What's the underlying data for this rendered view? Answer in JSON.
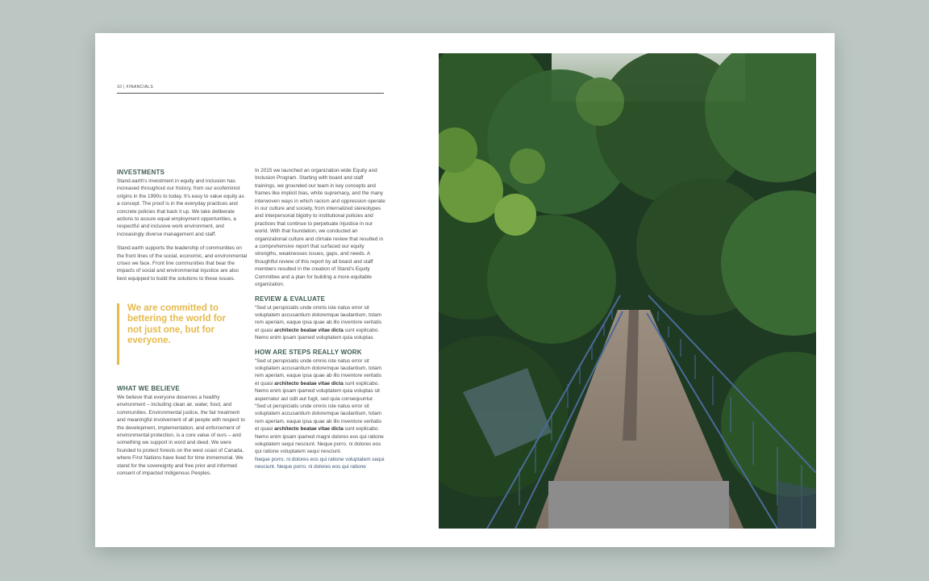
{
  "header": {
    "label": "10  |  FINANCIALS"
  },
  "investments": {
    "heading": "INVESTMENTS",
    "p1": "Stand.earth's investment in equity and inclusion has increased throughout our history, from our ecofeminist origins in the 1990s to today. It's easy to value equity as a concept. The proof is in the everyday practices and concrete policies that back it up. We take deliberate actions to assure equal employment opportunities, a respectful and inclusive work environment, and increasingly diverse management and staff.",
    "p2": "Stand.earth supports the leadership of communities on the front lines of the social, economic, and environmental crises we face. Front line communities that bear the impacts of social and environmental injustice are also best equipped to build the solutions to these issues."
  },
  "quote": {
    "text": "We are committed to bettering the world for not just one, but for everyone."
  },
  "believe": {
    "heading": "WHAT WE BELIEVE",
    "text": "We believe that everyone deserves a healthy environment – including clean air, water, food, and communities. Environmental justice, the fair treatment and meaningful involvement of all people with respect to the development, implementation, and enforcement of environmental protection, is a core value of ours – and something we support in word and deed. We were founded to protect forests on the west coast of Canada, where First Nations have lived for time immemorial. We stand for the sovereignty and free prior and informed consent of impacted Indigenous Peoples."
  },
  "intro": {
    "text": "In 2015 we launched an organization-wide Equity and Inclusion Program. Starting with board and staff trainings, we grounded our team in key concepts and frames like implicit bias, white supremacy, and the many interwoven ways in which racism and oppression operate in our culture and society, from internalized stereotypes and interpersonal bigotry to institutional policies and practices that continue to perpetuate injustice in our world. With that foundation, we conducted an organizational culture and climate review that resulted in a comprehensive report that surfaced our equity strengths, weaknesses issues, gaps, and needs. A thoughtful review of this report by all board and staff members resulted in the creation of Stand's Equity Committee and a plan for building a more equitable organization."
  },
  "review": {
    "heading": "REVIEW & EVALUATE",
    "before": "“Sed ut perspiciatis unde omnis iste natus error sit voluptatem accusantium doloremque laudantium, totam rem aperiam, eaque ipsa quae ab illo inventore veritatis et quasi ",
    "bold": "architecto beatae vitae dicta",
    "after": " sunt explicabo. Nemo enim ipsam ipamed voluptatem quia voluptas"
  },
  "steps": {
    "heading": "HOW ARE STEPS REALLY WORK",
    "a_before": "“Sed ut perspiciatis unde omnis iste natus error sit voluptatem accusantium doloremque laudantium, totam rem aperiam, eaque ipsa quae ab illo inventore veritatis et quasi ",
    "a_bold": "architecto beatae vitae dicta",
    "a_after": " sunt explicabo. Nemo enim ipsam ipamed voluptatem quia voluptas sit aspernatur aut odit aut fugit, sed quia consequuntur.",
    "b_before": "“Sed ut perspiciatis unde omnis iste natus error sit voluptatem accusantium doloremque laudantium, totam rem aperiam, eaque ipsa quae ab illo inventore veritatis et quasi ",
    "b_bold": "architecto beatae vitae dicta",
    "b_after": " sunt explicabo. Nemo enim ipsam ipamed magni dolores eos qui ratione voluptatem sequi nesciunt. Neque porro. ni dolores eos qui ratione voluptatem sequi nesciunt.",
    "blue": "Neque porro. ni dolores eos qui ratione voluptatem sequi nesciunt. Neque porro. ni dolores eos qui ratione"
  },
  "colors": {
    "accent": "#e6b94c",
    "heading": "#3f5d55",
    "background": "#bcc7c3"
  },
  "photo": {
    "subject": "forest-footbridge-photo"
  }
}
